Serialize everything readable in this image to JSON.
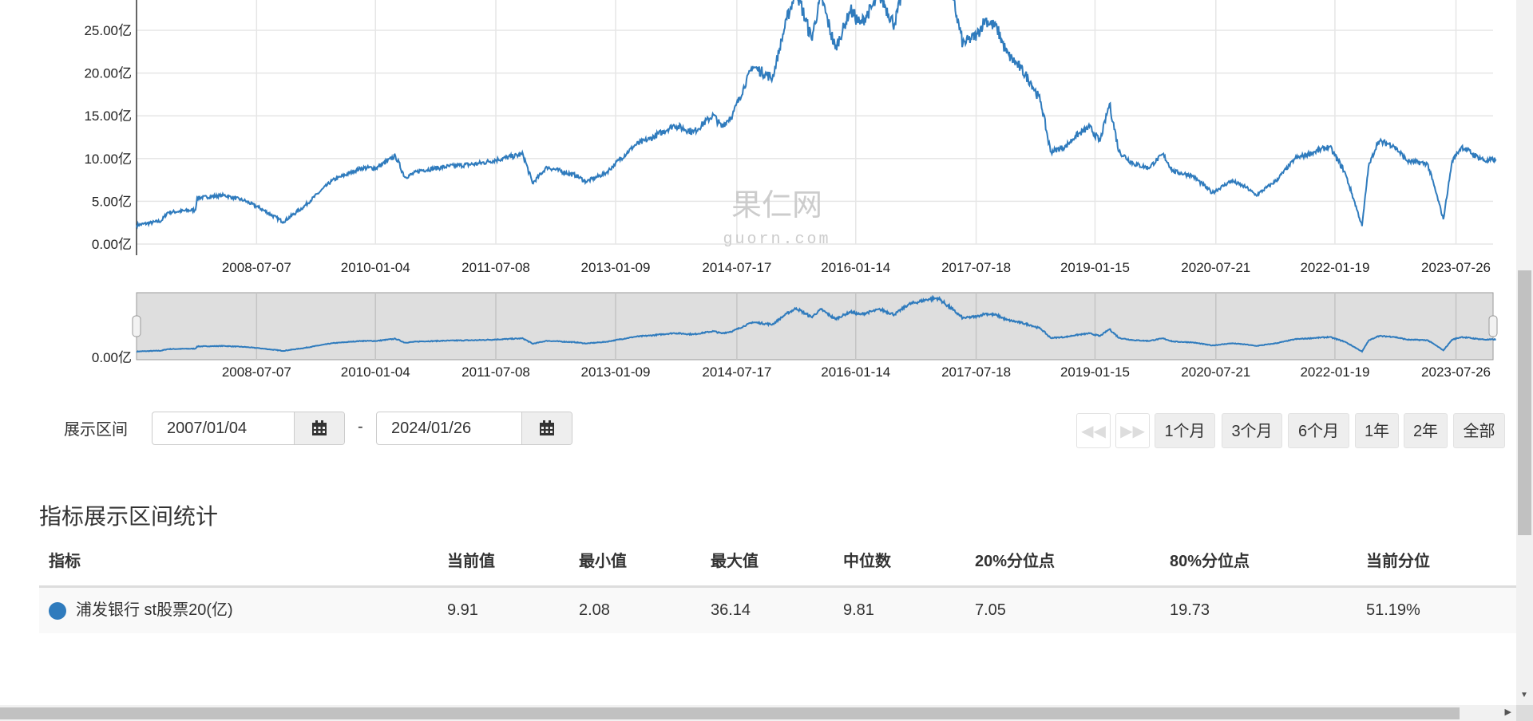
{
  "chart_data": {
    "type": "line",
    "series": [
      {
        "name": "浦发银行 st股票20(亿)",
        "color": "#2f7bbd",
        "x_year": [
          2007.01,
          2007.32,
          2007.4,
          2007.75,
          2007.77,
          2008.11,
          2008.36,
          2008.54,
          2008.85,
          2009.1,
          2009.46,
          2009.83,
          2010.02,
          2010.26,
          2010.38,
          2010.57,
          2010.94,
          2011.3,
          2011.55,
          2011.86,
          2011.98,
          2012.16,
          2012.53,
          2012.65,
          2012.9,
          2013.02,
          2013.27,
          2013.45,
          2013.76,
          2014.0,
          2014.25,
          2014.35,
          2014.49,
          2014.74,
          2014.99,
          2015.17,
          2015.29,
          2015.48,
          2015.6,
          2015.78,
          2015.97,
          2016.09,
          2016.34,
          2016.52,
          2016.7,
          2016.95,
          2017.07,
          2017.26,
          2017.38,
          2017.56,
          2017.66,
          2017.81,
          2017.93,
          2018.11,
          2018.24,
          2018.36,
          2018.48,
          2018.67,
          2018.79,
          2018.97,
          2019.1,
          2019.22,
          2019.34,
          2019.52,
          2019.71,
          2019.89,
          2020.02,
          2020.26,
          2020.51,
          2020.75,
          2020.94,
          2021.06,
          2021.31,
          2021.55,
          2021.8,
          2021.98,
          2022.17,
          2022.29,
          2022.39,
          2022.47,
          2022.59,
          2022.78,
          2022.96,
          2023.21,
          2023.31,
          2023.41,
          2023.52,
          2023.64,
          2023.82,
          2023.95,
          2024.07
        ],
        "values": [
          2.2,
          2.7,
          3.7,
          4.0,
          5.4,
          5.7,
          5.1,
          4.3,
          2.6,
          4.3,
          7.4,
          8.9,
          8.9,
          10.3,
          7.8,
          8.6,
          9.1,
          9.4,
          9.9,
          10.5,
          7.1,
          9.0,
          8.0,
          7.3,
          8.3,
          9.4,
          11.6,
          12.3,
          13.9,
          13.1,
          15.1,
          13.7,
          15.1,
          20.8,
          19.4,
          26.3,
          29.7,
          24.0,
          29.0,
          22.8,
          27.4,
          25.7,
          29.0,
          25.7,
          32.2,
          35.5,
          36.1,
          28.5,
          23.4,
          24.5,
          26.3,
          25.2,
          22.3,
          20.5,
          18.8,
          16.6,
          10.8,
          11.4,
          12.6,
          13.7,
          12.0,
          16.4,
          10.8,
          9.4,
          8.9,
          10.5,
          8.5,
          8.0,
          6.0,
          7.4,
          6.6,
          5.7,
          7.4,
          10.0,
          10.8,
          11.4,
          8.5,
          5.1,
          2.1,
          9.0,
          12.0,
          11.6,
          9.7,
          9.4,
          6.3,
          2.9,
          9.7,
          11.4,
          10.3,
          9.7,
          9.91
        ]
      }
    ],
    "y_ticks": [
      "0.00亿",
      "5.00亿",
      "10.00亿",
      "15.00亿",
      "20.00亿",
      "25.00亿"
    ],
    "y_tick_values": [
      0,
      5,
      10,
      15,
      20,
      25
    ],
    "x_ticks": [
      "2008-07-07",
      "2010-01-04",
      "2011-07-08",
      "2013-01-09",
      "2014-07-17",
      "2016-01-14",
      "2017-07-18",
      "2019-01-15",
      "2020-07-21",
      "2022-01-19",
      "2023-07-26"
    ],
    "navigator_y_tick": "0.00亿",
    "xlim": [
      "2007-01-04",
      "2024-01-26"
    ],
    "grid": true,
    "watermark": {
      "cn": "果仁网",
      "en": "guorn.com"
    }
  },
  "range": {
    "label": "展示区间",
    "start": "2007/01/04",
    "separator": "-",
    "end": "2024/01/26",
    "buttons": [
      "1个月",
      "3个月",
      "6个月",
      "1年",
      "2年",
      "全部"
    ]
  },
  "stats": {
    "title": "指标展示区间统计",
    "headers": [
      "指标",
      "当前值",
      "最小值",
      "最大值",
      "中位数",
      "20%分位点",
      "80%分位点",
      "当前分位"
    ],
    "rows": [
      [
        "浦发银行 st股票20(亿)",
        "9.91",
        "2.08",
        "36.14",
        "9.81",
        "7.05",
        "19.73",
        "51.19%"
      ]
    ]
  }
}
